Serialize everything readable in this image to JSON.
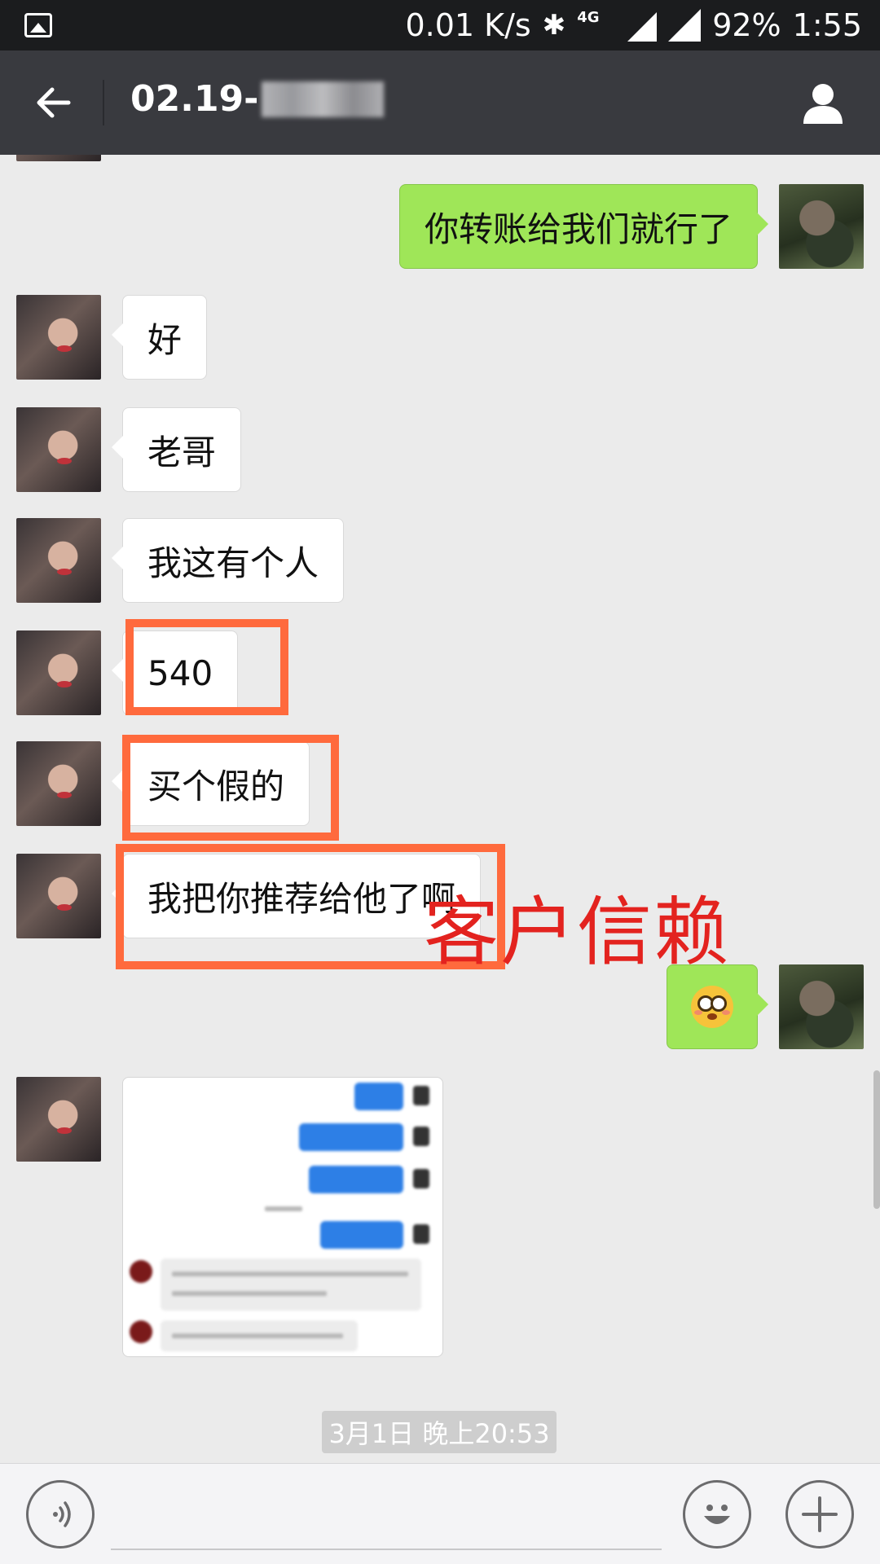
{
  "status_bar": {
    "speed": "0.01 K/s",
    "network": "4G",
    "battery": "92%",
    "time": "1:55",
    "icons": [
      "image-icon",
      "bluetooth-icon",
      "signal-icon",
      "wifi-icon"
    ]
  },
  "header": {
    "title_visible": "02.19-",
    "back_icon": "back-arrow-icon",
    "profile_icon": "person-icon"
  },
  "messages": [
    {
      "side": "right",
      "type": "text",
      "text": "你转账给我们就行了"
    },
    {
      "side": "left",
      "type": "text",
      "text": "好"
    },
    {
      "side": "left",
      "type": "text",
      "text": "老哥"
    },
    {
      "side": "left",
      "type": "text",
      "text": "我这有个人"
    },
    {
      "side": "left",
      "type": "text",
      "text": "540"
    },
    {
      "side": "left",
      "type": "text",
      "text": "买个假的"
    },
    {
      "side": "left",
      "type": "text",
      "text": "我把你推荐给他了啊"
    },
    {
      "side": "right",
      "type": "emoji",
      "text": "flushed-face-emoji"
    },
    {
      "side": "left",
      "type": "image",
      "text": "blurred-chat-screenshot"
    }
  ],
  "annotation": {
    "text": "客户信赖",
    "color": "#e3231f",
    "highlight_color": "#ff6a3d"
  },
  "timestamp": "3月1日 晚上20:53",
  "input_bar": {
    "voice_icon": "voice-icon",
    "emoji_icon": "smiley-icon",
    "plus_icon": "plus-icon"
  },
  "colors": {
    "header_bg": "#393a3f",
    "chat_bg": "#ebebeb",
    "my_bubble": "#9fe658",
    "their_bubble": "#ffffff"
  }
}
